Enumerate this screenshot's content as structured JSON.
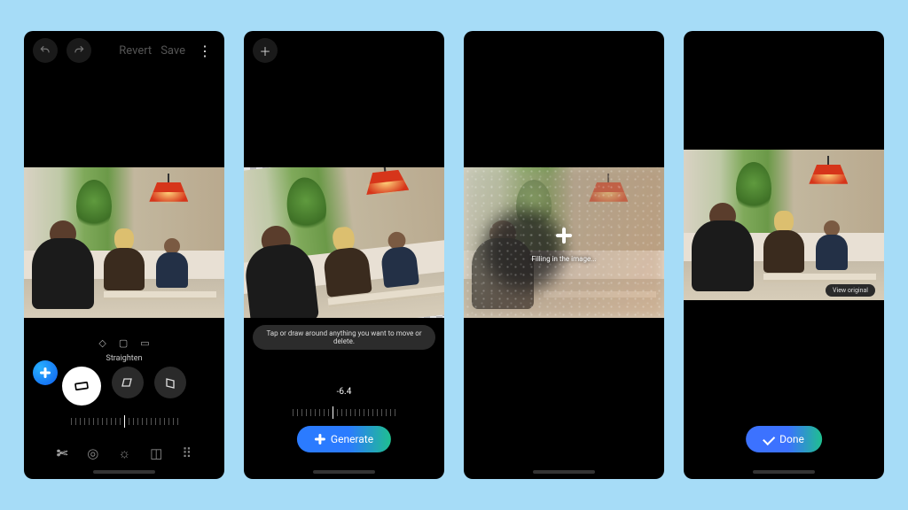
{
  "panel1": {
    "revert_label": "Revert",
    "save_label": "Save",
    "straighten_label": "Straighten"
  },
  "panel2": {
    "hint": "Tap or draw around anything you want to move or delete.",
    "angle_value": "-6.4",
    "generate_label": "Generate"
  },
  "panel3": {
    "filling_label": "Filling in the image..."
  },
  "panel4": {
    "done_label": "Done",
    "view_original_label": "View original"
  }
}
